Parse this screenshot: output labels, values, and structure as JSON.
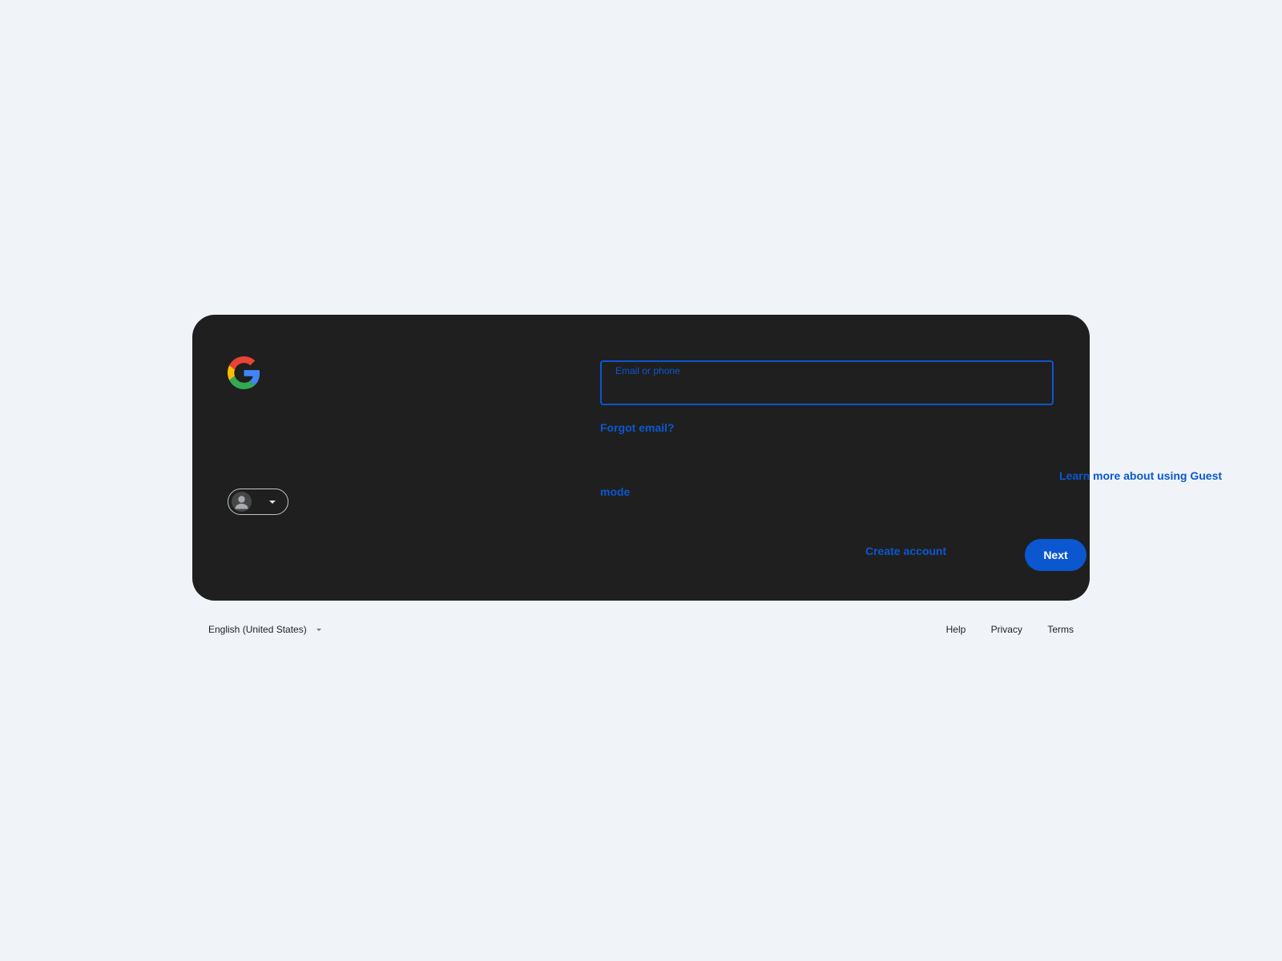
{
  "icons": {
    "logo": "google-g-logo",
    "avatar": "person-icon",
    "account_caret": "chevron-down-icon",
    "language_caret": "chevron-down-icon"
  },
  "colors": {
    "page_bg": "#f0f4f9",
    "card_bg": "#1f1f1f",
    "accent": "#0b57d0",
    "google_blue": "#4285f4",
    "google_red": "#ea4335",
    "google_yellow": "#fbbc05",
    "google_green": "#34a853"
  },
  "signin": {
    "email_label": "Email or phone",
    "email_value": "",
    "forgot_email": "Forgot email?",
    "guest_mode_link_line1": "Learn more about using Guest",
    "guest_mode_link_line2": "mode",
    "create_account": "Create account",
    "next": "Next"
  },
  "footer": {
    "language": "English (United States)",
    "links": [
      "Help",
      "Privacy",
      "Terms"
    ]
  }
}
